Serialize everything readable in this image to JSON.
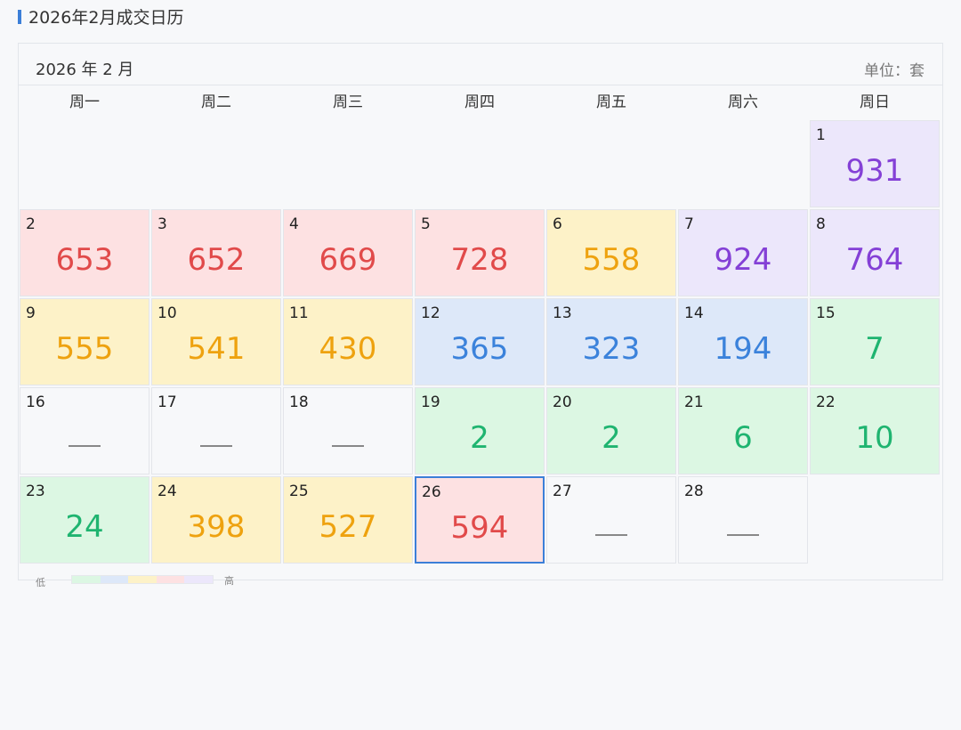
{
  "page_title": "2026年2月成交日历",
  "header": {
    "month": "2026 年 2 月",
    "unit": "单位：套"
  },
  "weekdays": [
    "周一",
    "周二",
    "周三",
    "周四",
    "周五",
    "周六",
    "周日"
  ],
  "colors": {
    "none": "#f7f8fa",
    "green": "#dcf7e3",
    "blue": "#dde8f9",
    "yellow": "#fdf2c8",
    "red": "#fde1e2",
    "purple": "#ece7fb",
    "accent": "#3c7fd8"
  },
  "empty_value_text": "—",
  "days": [
    {
      "day": "1",
      "value": "931",
      "level": "purple",
      "col": 6
    },
    {
      "day": "2",
      "value": "653",
      "level": "red",
      "col": 0
    },
    {
      "day": "3",
      "value": "652",
      "level": "red",
      "col": 1
    },
    {
      "day": "4",
      "value": "669",
      "level": "red",
      "col": 2
    },
    {
      "day": "5",
      "value": "728",
      "level": "red",
      "col": 3
    },
    {
      "day": "6",
      "value": "558",
      "level": "yellow",
      "col": 4
    },
    {
      "day": "7",
      "value": "924",
      "level": "purple",
      "col": 5
    },
    {
      "day": "8",
      "value": "764",
      "level": "purple",
      "col": 6
    },
    {
      "day": "9",
      "value": "555",
      "level": "yellow",
      "col": 0
    },
    {
      "day": "10",
      "value": "541",
      "level": "yellow",
      "col": 1
    },
    {
      "day": "11",
      "value": "430",
      "level": "yellow",
      "col": 2
    },
    {
      "day": "12",
      "value": "365",
      "level": "blue",
      "col": 3
    },
    {
      "day": "13",
      "value": "323",
      "level": "blue",
      "col": 4
    },
    {
      "day": "14",
      "value": "194",
      "level": "blue",
      "col": 5
    },
    {
      "day": "15",
      "value": "7",
      "level": "green",
      "col": 6
    },
    {
      "day": "16",
      "value": null,
      "level": "none",
      "col": 0
    },
    {
      "day": "17",
      "value": null,
      "level": "none",
      "col": 1
    },
    {
      "day": "18",
      "value": null,
      "level": "none",
      "col": 2
    },
    {
      "day": "19",
      "value": "2",
      "level": "green",
      "col": 3
    },
    {
      "day": "20",
      "value": "2",
      "level": "green",
      "col": 4
    },
    {
      "day": "21",
      "value": "6",
      "level": "green",
      "col": 5
    },
    {
      "day": "22",
      "value": "10",
      "level": "green",
      "col": 6
    },
    {
      "day": "23",
      "value": "24",
      "level": "green",
      "col": 0
    },
    {
      "day": "24",
      "value": "398",
      "level": "yellow",
      "col": 1
    },
    {
      "day": "25",
      "value": "527",
      "level": "yellow",
      "col": 2
    },
    {
      "day": "26",
      "value": "594",
      "level": "red",
      "col": 3,
      "selected": true
    },
    {
      "day": "27",
      "value": null,
      "level": "none",
      "col": 4
    },
    {
      "day": "28",
      "value": null,
      "level": "none",
      "col": 5
    }
  ],
  "legend": {
    "low": "低",
    "high": "高",
    "levels": [
      "green",
      "blue",
      "yellow",
      "red",
      "purple"
    ]
  }
}
